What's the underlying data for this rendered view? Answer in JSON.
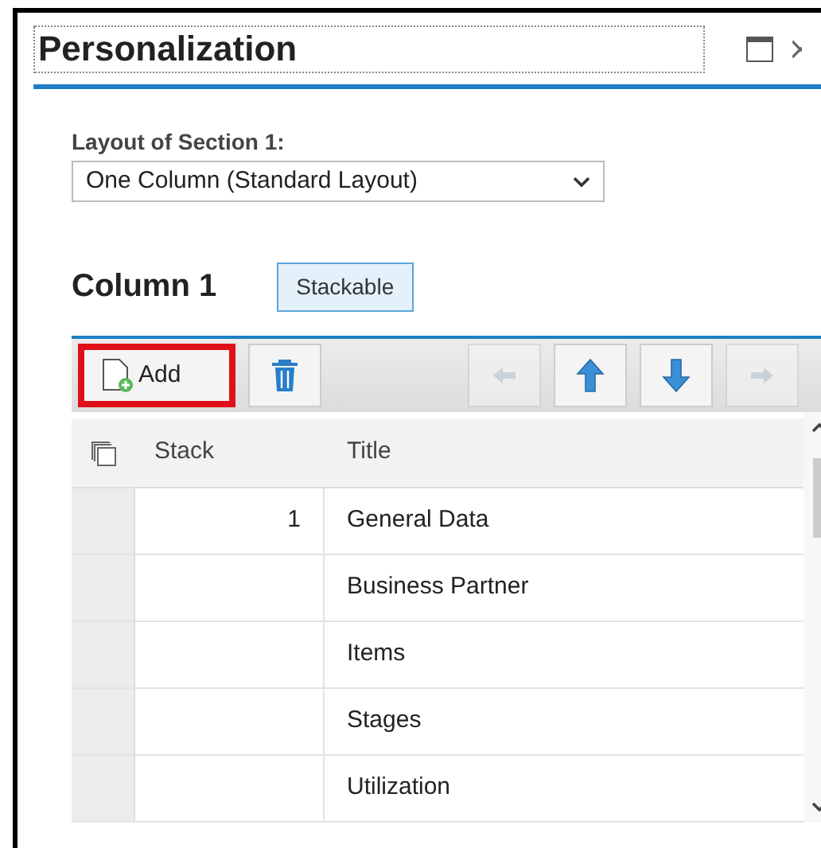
{
  "window": {
    "title": "Personalization"
  },
  "layout_field": {
    "label": "Layout of Section 1:",
    "value": "One Column (Standard Layout)"
  },
  "column": {
    "title": "Column 1",
    "button": "Stackable"
  },
  "toolbar": [
    {
      "kind": "add",
      "label": "Add",
      "highlighted": true,
      "disabled": false
    },
    {
      "kind": "delete",
      "highlighted": false,
      "disabled": false
    },
    {
      "kind": "left",
      "highlighted": false,
      "disabled": true
    },
    {
      "kind": "up",
      "highlighted": false,
      "disabled": false
    },
    {
      "kind": "down",
      "highlighted": false,
      "disabled": false
    },
    {
      "kind": "right",
      "highlighted": false,
      "disabled": true
    }
  ],
  "table": {
    "columns": [
      "Stack",
      "Title"
    ],
    "rows": [
      {
        "stack": "1",
        "title": "General Data"
      },
      {
        "title": "Business Partner"
      },
      {
        "title": "Items"
      },
      {
        "title": "Stages"
      },
      {
        "title": "Utilization"
      }
    ]
  }
}
